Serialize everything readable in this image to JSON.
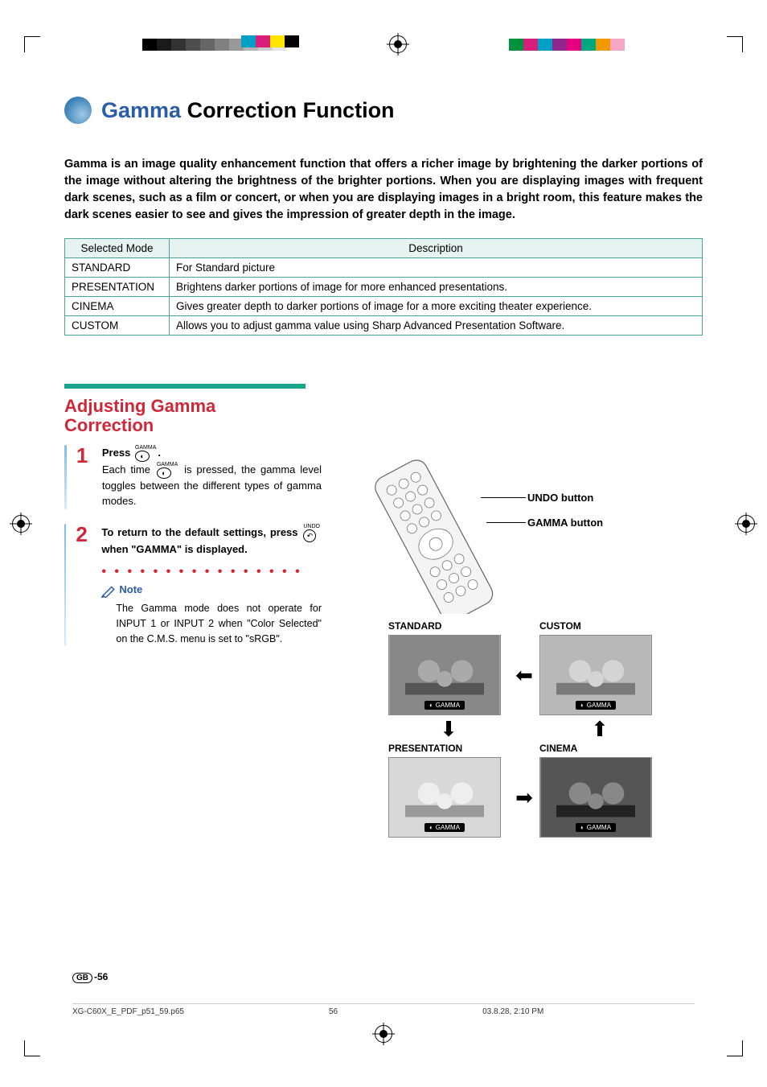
{
  "title": {
    "blue": "Gamma",
    "black": " Correction Function"
  },
  "intro": "Gamma is an image quality enhancement function that offers a richer image by brightening the darker portions of the image without altering the brightness of the brighter portions. When you are displaying images with frequent dark scenes, such as a film or concert, or when you are displaying images in a bright room, this feature makes the dark scenes easier to see and gives the impression of greater depth in the image.",
  "table": {
    "headers": {
      "mode": "Selected Mode",
      "desc": "Description"
    },
    "rows": [
      {
        "mode": "STANDARD",
        "desc": "For Standard picture"
      },
      {
        "mode": "PRESENTATION",
        "desc": "Brightens darker portions of image for more enhanced presentations."
      },
      {
        "mode": "CINEMA",
        "desc": "Gives greater depth to darker portions of image for a more exciting theater experience."
      },
      {
        "mode": "CUSTOM",
        "desc": "Allows you to adjust gamma value using Sharp Advanced Presentation Software."
      }
    ]
  },
  "section_heading": "Adjusting Gamma Correction",
  "steps": {
    "s1": {
      "num": "1",
      "lead_a": "Press ",
      "lead_b": ".",
      "body_a": "Each time ",
      "body_b": " is pressed, the gamma level toggles between the different types of gamma modes.",
      "gamma_label": "GAMMA"
    },
    "s2": {
      "num": "2",
      "lead_a": "To return to the default settings, press ",
      "lead_b": " when \"GAMMA\" is displayed.",
      "undo_label": "UNDO"
    }
  },
  "note": {
    "label": "Note",
    "body": "The Gamma mode does not operate for INPUT 1 or INPUT 2 when \"Color Selected\" on the C.M.S. menu is set to \"sRGB\"."
  },
  "callouts": {
    "undo": "UNDO button",
    "gamma": "GAMMA button"
  },
  "thumbs": {
    "tl": "STANDARD",
    "tr": "CUSTOM",
    "bl": "PRESENTATION",
    "br": "CINEMA",
    "gamma_tag": "GAMMA",
    "sub": {
      "tl": "STANDARD",
      "tr": "CUSTOM",
      "bl": "PRESENTATION",
      "br": "CINEMA"
    }
  },
  "footer": {
    "gb": "GB",
    "page": "-56"
  },
  "print": {
    "file": "XG-C60X_E_PDF_p51_59.p65",
    "pg": "56",
    "ts": "03.8.28, 2:10 PM"
  },
  "colors": {
    "grays": [
      "#000000",
      "#1a1a1a",
      "#333333",
      "#4d4d4d",
      "#666666",
      "#808080",
      "#999999",
      "#b3b3b3",
      "#cccccc",
      "#e5e5e5"
    ],
    "cmyk": [
      "#00a0c6",
      "#d81e7a",
      "#ffe600",
      "#000000"
    ],
    "right": [
      "#00923f",
      "#d81e7a",
      "#00a0c6",
      "#92268f",
      "#e4007f",
      "#00a881",
      "#f39800",
      "#f5a6c5"
    ]
  }
}
